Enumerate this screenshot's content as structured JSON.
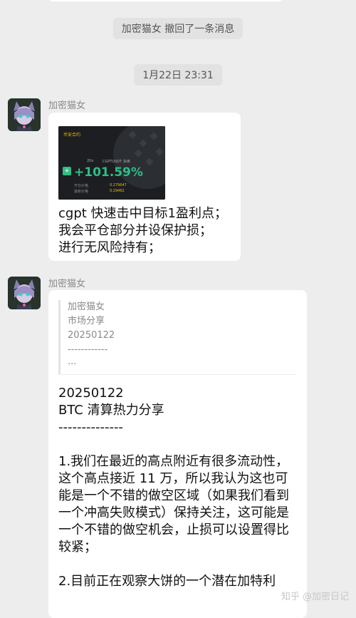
{
  "system": {
    "recall_notice": "加密猫女 撤回了一条消息",
    "timestamp": "1月22日 23:31"
  },
  "messages": [
    {
      "sender": "加密猫女",
      "card": {
        "brand": "币安合约",
        "leverage": "20x",
        "pair": "CGPTUSDT 永续",
        "pnl_pct": "+101.59%",
        "open_label": "开仓价格",
        "open_value": "0.279647",
        "last_label": "最新价格",
        "last_value": "0.29462"
      },
      "text": "cgpt 快速击中目标1盈利点；\n我会平仓部分并设保护损；\n进行无风险持有；"
    },
    {
      "sender": "加密猫女",
      "quote": {
        "name": "加密猫女",
        "title": "市场分享",
        "date": "20250122",
        "dashes": "------------",
        "ellipsis": "..."
      },
      "text": "20250122\nBTC 清算热力分享\n--------------\n\n1.我们在最近的高点附近有很多流动性，这个高点接近 11 万，所以我认为这也可能是一个不错的做空区域（如果我们看到一个冲高失败模式）保持关注，这可能是一个不错的做空机会，止损可以设置得比较紧；\n\n2.目前正在观察大饼的一个潜在加特利"
    }
  ],
  "watermark": "知乎 @加密日记",
  "colors": {
    "background": "#ededed",
    "bubble": "#ffffff",
    "profit_green": "#2ebd85",
    "binance_yellow": "#f0b90b"
  }
}
